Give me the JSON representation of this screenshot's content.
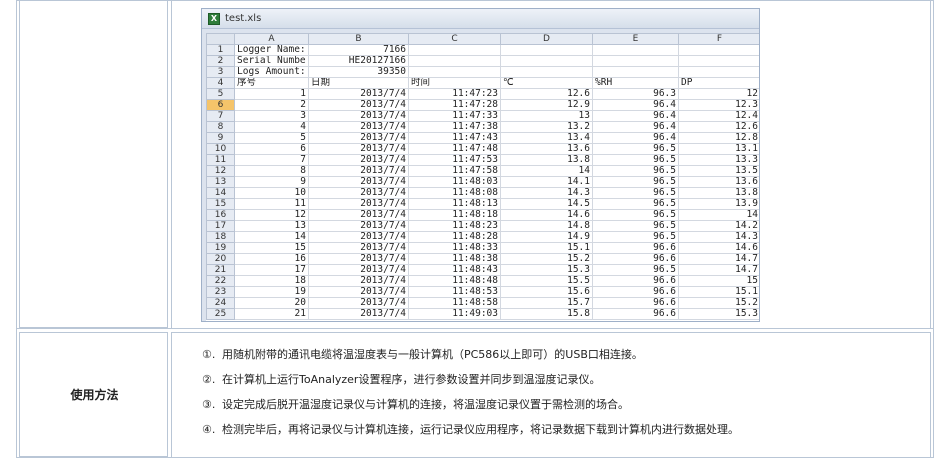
{
  "method": {
    "label": "使用方法",
    "steps": [
      {
        "num": "①.",
        "text": "用随机附带的通讯电缆将温湿度表与一般计算机（PC586以上即可）的USB口相连接。"
      },
      {
        "num": "②.",
        "text": "在计算机上运行ToAnalyzer设置程序，进行参数设置并同步到温湿度记录仪。"
      },
      {
        "num": "③.",
        "text": "设定完成后脱开温湿度记录仪与计算机的连接，将温湿度记录仪置于需检测的场合。"
      },
      {
        "num": "④.",
        "text": "检测完毕后，再将记录仪与计算机连接，运行记录仪应用程序，将记录数据下载到计算机内进行数据处理。"
      }
    ]
  },
  "spreadsheet": {
    "window_title": "test.xls",
    "columns": [
      "A",
      "B",
      "C",
      "D",
      "E",
      "F"
    ],
    "header_rows": [
      {
        "row": "1",
        "a": "Logger Name:",
        "b": "7166",
        "c": "",
        "d": "",
        "e": "",
        "f": ""
      },
      {
        "row": "2",
        "a": "Serial Numbe",
        "b": "HE20127166",
        "c": "",
        "d": "",
        "e": "",
        "f": ""
      },
      {
        "row": "3",
        "a": "Logs Amount:",
        "b": "39350",
        "c": "",
        "d": "",
        "e": "",
        "f": ""
      },
      {
        "row": "4",
        "a": "序号",
        "b": "日期",
        "c": "时间",
        "d": "℃",
        "e": "%RH",
        "f": "DP"
      }
    ],
    "selected_row": "6",
    "data_rows": [
      {
        "row": "5",
        "seq": "1",
        "date": "2013/7/4",
        "time": "11:47:23",
        "temp": "12.6",
        "rh": "96.3",
        "dp": "12"
      },
      {
        "row": "6",
        "seq": "2",
        "date": "2013/7/4",
        "time": "11:47:28",
        "temp": "12.9",
        "rh": "96.4",
        "dp": "12.3"
      },
      {
        "row": "7",
        "seq": "3",
        "date": "2013/7/4",
        "time": "11:47:33",
        "temp": "13",
        "rh": "96.4",
        "dp": "12.4"
      },
      {
        "row": "8",
        "seq": "4",
        "date": "2013/7/4",
        "time": "11:47:38",
        "temp": "13.2",
        "rh": "96.4",
        "dp": "12.6"
      },
      {
        "row": "9",
        "seq": "5",
        "date": "2013/7/4",
        "time": "11:47:43",
        "temp": "13.4",
        "rh": "96.4",
        "dp": "12.8"
      },
      {
        "row": "10",
        "seq": "6",
        "date": "2013/7/4",
        "time": "11:47:48",
        "temp": "13.6",
        "rh": "96.5",
        "dp": "13.1"
      },
      {
        "row": "11",
        "seq": "7",
        "date": "2013/7/4",
        "time": "11:47:53",
        "temp": "13.8",
        "rh": "96.5",
        "dp": "13.3"
      },
      {
        "row": "12",
        "seq": "8",
        "date": "2013/7/4",
        "time": "11:47:58",
        "temp": "14",
        "rh": "96.5",
        "dp": "13.5"
      },
      {
        "row": "13",
        "seq": "9",
        "date": "2013/7/4",
        "time": "11:48:03",
        "temp": "14.1",
        "rh": "96.5",
        "dp": "13.6"
      },
      {
        "row": "14",
        "seq": "10",
        "date": "2013/7/4",
        "time": "11:48:08",
        "temp": "14.3",
        "rh": "96.5",
        "dp": "13.8"
      },
      {
        "row": "15",
        "seq": "11",
        "date": "2013/7/4",
        "time": "11:48:13",
        "temp": "14.5",
        "rh": "96.5",
        "dp": "13.9"
      },
      {
        "row": "16",
        "seq": "12",
        "date": "2013/7/4",
        "time": "11:48:18",
        "temp": "14.6",
        "rh": "96.5",
        "dp": "14"
      },
      {
        "row": "17",
        "seq": "13",
        "date": "2013/7/4",
        "time": "11:48:23",
        "temp": "14.8",
        "rh": "96.5",
        "dp": "14.2"
      },
      {
        "row": "18",
        "seq": "14",
        "date": "2013/7/4",
        "time": "11:48:28",
        "temp": "14.9",
        "rh": "96.5",
        "dp": "14.3"
      },
      {
        "row": "19",
        "seq": "15",
        "date": "2013/7/4",
        "time": "11:48:33",
        "temp": "15.1",
        "rh": "96.6",
        "dp": "14.6"
      },
      {
        "row": "20",
        "seq": "16",
        "date": "2013/7/4",
        "time": "11:48:38",
        "temp": "15.2",
        "rh": "96.6",
        "dp": "14.7"
      },
      {
        "row": "21",
        "seq": "17",
        "date": "2013/7/4",
        "time": "11:48:43",
        "temp": "15.3",
        "rh": "96.5",
        "dp": "14.7"
      },
      {
        "row": "22",
        "seq": "18",
        "date": "2013/7/4",
        "time": "11:48:48",
        "temp": "15.5",
        "rh": "96.6",
        "dp": "15"
      },
      {
        "row": "23",
        "seq": "19",
        "date": "2013/7/4",
        "time": "11:48:53",
        "temp": "15.6",
        "rh": "96.6",
        "dp": "15.1"
      },
      {
        "row": "24",
        "seq": "20",
        "date": "2013/7/4",
        "time": "11:48:58",
        "temp": "15.7",
        "rh": "96.6",
        "dp": "15.2"
      },
      {
        "row": "25",
        "seq": "21",
        "date": "2013/7/4",
        "time": "11:49:03",
        "temp": "15.8",
        "rh": "96.6",
        "dp": "15.3"
      }
    ]
  }
}
